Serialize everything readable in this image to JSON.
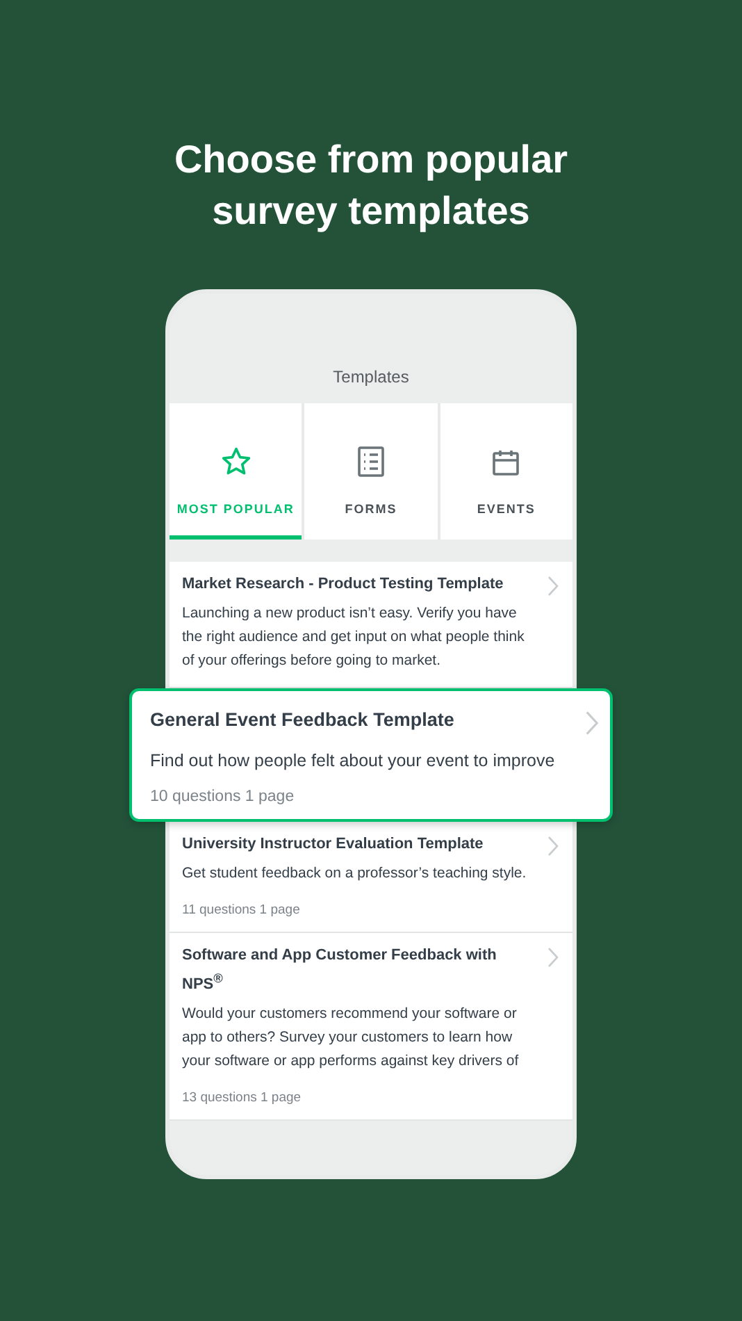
{
  "headline": "Choose from popular survey templates",
  "header": {
    "title": "Templates"
  },
  "tabs": [
    {
      "label": "MOST POPULAR",
      "kind": "star",
      "selected": true
    },
    {
      "label": "FORMS",
      "kind": "form",
      "selected": false
    },
    {
      "label": "EVENTS",
      "kind": "calendar",
      "selected": false
    }
  ],
  "templates": [
    {
      "title": "Market Research - Product Testing Template",
      "description": "Launching a new product isn’t easy. Verify you have the right audience and get input on what people think of your offerings before going to market.",
      "highlighted": false
    },
    {
      "title": "General Event Feedback Template",
      "description": "Find out how people felt about your event to improve",
      "meta": "10 questions 1 page",
      "highlighted": true
    },
    {
      "title": "University Instructor Evaluation Template",
      "description": "Get student feedback on a professor’s teaching style.",
      "meta": "11 questions 1 page",
      "highlighted": false
    },
    {
      "title": "Software and App Customer Feedback with NPS$^{®}$",
      "description": "Would your customers recommend your software or app to others? Survey your customers to learn how your software or app performs against key drivers of",
      "meta": "13 questions 1 page",
      "highlighted": false
    }
  ]
}
